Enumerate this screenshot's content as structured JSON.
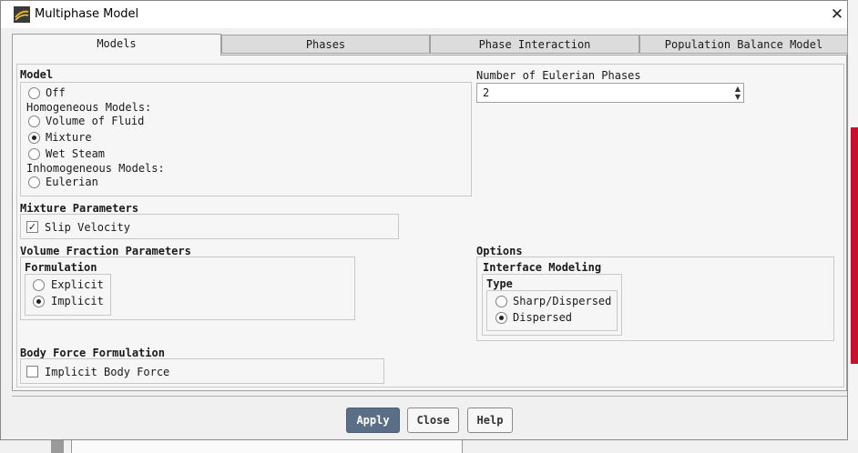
{
  "window": {
    "title": "Multiphase Model",
    "close_glyph": "✕",
    "icon": "fluent-app-icon"
  },
  "tabs": [
    {
      "label": "Models",
      "active": true
    },
    {
      "label": "Phases",
      "active": false
    },
    {
      "label": "Phase Interaction",
      "active": false
    },
    {
      "label": "Population Balance Model",
      "active": false
    }
  ],
  "model": {
    "label": "Model",
    "off": "Off",
    "homogeneous_label": "Homogeneous Models:",
    "vof": "Volume of Fluid",
    "mixture": "Mixture",
    "wet_steam": "Wet Steam",
    "inhomogeneous_label": "Inhomogeneous Models:",
    "eulerian": "Eulerian",
    "selected": "Mixture"
  },
  "phases": {
    "label": "Number of Eulerian Phases",
    "value": "2",
    "up": "▲",
    "down": "▼"
  },
  "mixture_params": {
    "label": "Mixture Parameters",
    "slip_velocity": "Slip Velocity",
    "slip_checked": true,
    "check_glyph": "✓"
  },
  "vfp": {
    "label": "Volume Fraction Parameters",
    "formulation_label": "Formulation",
    "explicit": "Explicit",
    "implicit": "Implicit",
    "selected": "Implicit"
  },
  "options": {
    "label": "Options",
    "interface_label": "Interface Modeling",
    "type_label": "Type",
    "sharp": "Sharp/Dispersed",
    "dispersed": "Dispersed",
    "selected": "Dispersed"
  },
  "body_force": {
    "label": "Body Force Formulation",
    "implicit": "Implicit Body Force",
    "checked": false
  },
  "buttons": {
    "apply": "Apply",
    "close": "Close",
    "help": "Help"
  },
  "colors": {
    "primary_button": "#5a6f86",
    "panel": "#f6f6f6",
    "border": "#a0a0a0"
  }
}
